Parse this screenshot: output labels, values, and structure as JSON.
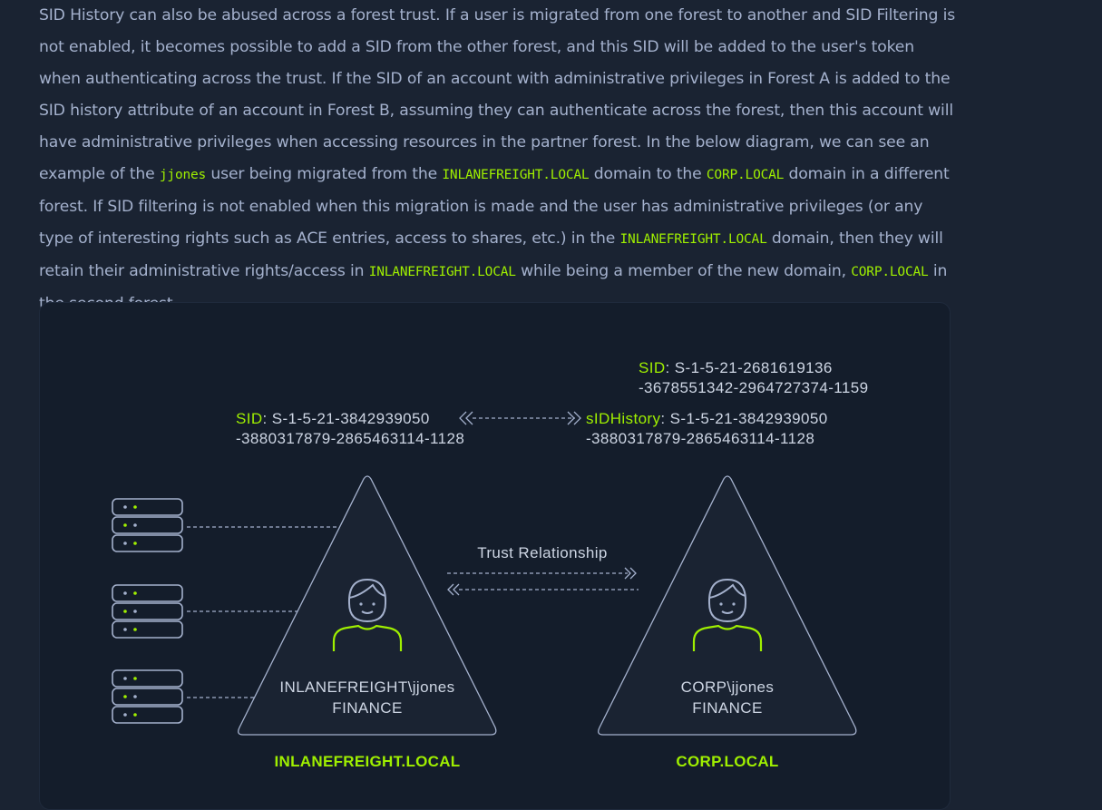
{
  "article": {
    "segments": [
      {
        "text": "SID History can also be abused across a forest trust. If a user is migrated from one forest to another and SID Filtering is not enabled, it becomes possible to add a SID from the other forest, and this SID will be added to the user's token when authenticating across the trust. If the SID of an account with administrative privileges in Forest A is added to the SID history attribute of an account in Forest B, assuming they can authenticate across the forest, then this account will have administrative privileges when accessing resources in the partner forest. In the below diagram, we can see an example of the ",
        "code": false
      },
      {
        "text": "jjones",
        "code": true
      },
      {
        "text": " user being migrated from the ",
        "code": false
      },
      {
        "text": "INLANEFREIGHT.LOCAL",
        "code": true
      },
      {
        "text": " domain to the ",
        "code": false
      },
      {
        "text": "CORP.LOCAL",
        "code": true
      },
      {
        "text": " domain in a different forest. If SID filtering is not enabled when this migration is made and the user has administrative privileges (or any type of interesting rights such as ACE entries, access to shares, etc.) in the ",
        "code": false
      },
      {
        "text": "INLANEFREIGHT.LOCAL",
        "code": true
      },
      {
        "text": " domain, then they will retain their administrative rights/access in ",
        "code": false
      },
      {
        "text": "INLANEFREIGHT.LOCAL",
        "code": true
      },
      {
        "text": " while being a member of the new domain, ",
        "code": false
      },
      {
        "text": "CORP.LOCAL",
        "code": true
      },
      {
        "text": " in the second forest.",
        "code": false
      }
    ]
  },
  "diagram": {
    "left_sid": {
      "key": "SID",
      "sep": ":",
      "line1": " S-1-5-21-3842939050",
      "line2": "-3880317879-2865463114-1128"
    },
    "right_sid": {
      "key": "SID",
      "sep": ":",
      "line1": " S-1-5-21-2681619136",
      "line2": "-3678551342-2964727374-1159"
    },
    "right_sidhistory": {
      "key": "sIDHistory",
      "sep": ":",
      "line1": " S-1-5-21-3842939050",
      "line2": "-3880317879-2865463114-1128"
    },
    "trust_label": "Trust Relationship",
    "left_forest": {
      "user": "INLANEFREIGHT\\jjones",
      "group": "FINANCE",
      "domain": "INLANEFREIGHT.LOCAL"
    },
    "right_forest": {
      "user": "CORP\\jjones",
      "group": "FINANCE",
      "domain": "CORP.LOCAL"
    },
    "colors": {
      "accent": "#9fef00",
      "text": "#cdd5e3",
      "line": "#a4b1cd",
      "panel": "#141d2b",
      "triangle": "#1a2332"
    },
    "icons": [
      "server-icon",
      "user-icon",
      "chevron-double-left-icon",
      "chevron-double-right-icon"
    ]
  }
}
